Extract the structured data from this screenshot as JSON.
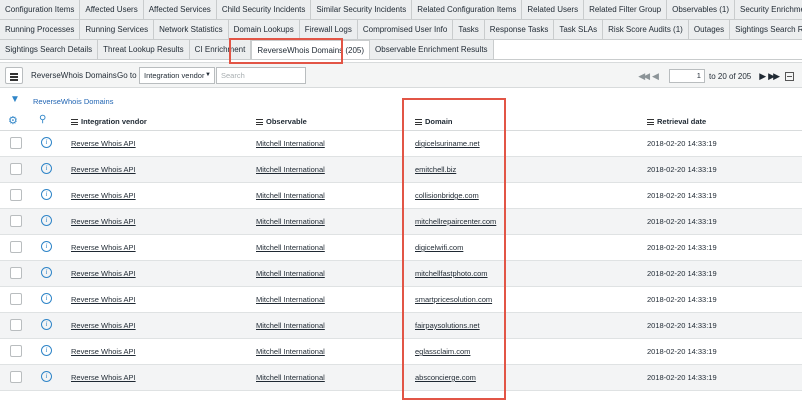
{
  "tabs_row1": [
    "Configuration Items",
    "Affected Users",
    "Affected Services",
    "Child Security Incidents",
    "Similar Security Incidents",
    "Related Configuration Items",
    "Related Users",
    "Related Filter Group",
    "Observables (1)",
    "Security Enrichment Data"
  ],
  "tabs_row2": [
    "Running Processes",
    "Running Services",
    "Network Statistics",
    "Domain Lookups",
    "Firewall Logs",
    "Compromised User Info",
    "Tasks",
    "Response Tasks",
    "Task SLAs",
    "Risk Score Audits (1)",
    "Outages",
    "Sightings Search Results"
  ],
  "tabs_row3": [
    "Sightings Search Details",
    "Threat Lookup Results",
    "CI Enrichment",
    "ReverseWhois Domains (205)",
    "Observable Enrichment Results"
  ],
  "active_tab": "ReverseWhois Domains (205)",
  "toolbar": {
    "title": "ReverseWhois Domains",
    "goto_label": "Go to",
    "goto_select": "Integration vendor",
    "search_placeholder": "Search",
    "page_value": "1",
    "page_range": "to 20 of 205"
  },
  "filter": {
    "link": "ReverseWhois Domains"
  },
  "columns": [
    "Integration vendor",
    "Observable",
    "Domain",
    "Retrieval date"
  ],
  "rows": [
    {
      "vendor": "Reverse Whois API",
      "observable": "Mitchell International",
      "domain": "digicelsuriname.net",
      "date": "2018-02-20 14:33:19"
    },
    {
      "vendor": "Reverse Whois API",
      "observable": "Mitchell International",
      "domain": "emitchell.biz",
      "date": "2018-02-20 14:33:19"
    },
    {
      "vendor": "Reverse Whois API",
      "observable": "Mitchell International",
      "domain": "collisionbridge.com",
      "date": "2018-02-20 14:33:19"
    },
    {
      "vendor": "Reverse Whois API",
      "observable": "Mitchell International",
      "domain": "mitchellrepaircenter.com",
      "date": "2018-02-20 14:33:19"
    },
    {
      "vendor": "Reverse Whois API",
      "observable": "Mitchell International",
      "domain": "digicelwifi.com",
      "date": "2018-02-20 14:33:19"
    },
    {
      "vendor": "Reverse Whois API",
      "observable": "Mitchell International",
      "domain": "mitchellfastphoto.com",
      "date": "2018-02-20 14:33:19"
    },
    {
      "vendor": "Reverse Whois API",
      "observable": "Mitchell International",
      "domain": "smartpricesolution.com",
      "date": "2018-02-20 14:33:19"
    },
    {
      "vendor": "Reverse Whois API",
      "observable": "Mitchell International",
      "domain": "fairpaysolutions.net",
      "date": "2018-02-20 14:33:19"
    },
    {
      "vendor": "Reverse Whois API",
      "observable": "Mitchell International",
      "domain": "eglassclaim.com",
      "date": "2018-02-20 14:33:19"
    },
    {
      "vendor": "Reverse Whois API",
      "observable": "Mitchell International",
      "domain": "absconcierge.com",
      "date": "2018-02-20 14:33:19"
    }
  ]
}
